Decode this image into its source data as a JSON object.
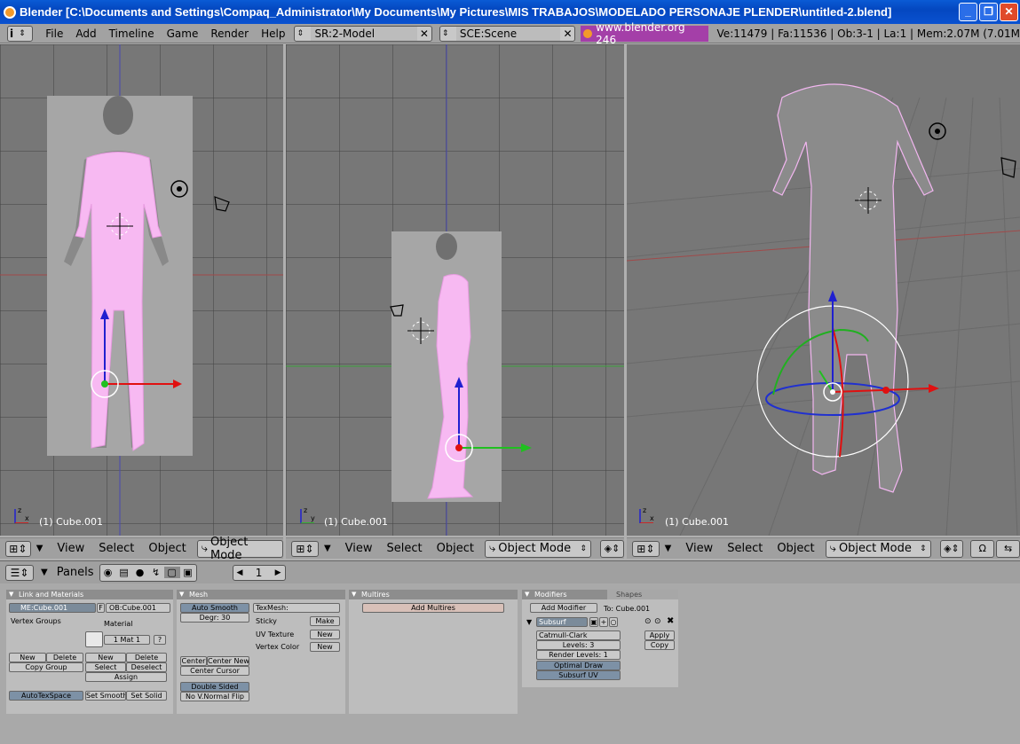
{
  "window": {
    "title": "Blender [C:\\Documents and Settings\\Compaq_Administrator\\My Documents\\My Pictures\\MIS TRABAJOS\\MODELADO PERSONAJE PLENDER\\untitled-2.blend]",
    "minimize": "_",
    "maximize": "❐",
    "close": "✕"
  },
  "info_header": {
    "menus": [
      "File",
      "Add",
      "Timeline",
      "Game",
      "Render",
      "Help"
    ],
    "screen": "SR:2-Model",
    "scene": "SCE:Scene",
    "website": "www.blender.org 246",
    "stats": "Ve:11479 | Fa:11536 | Ob:3-1 | La:1  | Mem:2.07M (7.01M"
  },
  "viewports": [
    {
      "label": "(1) Cube.001"
    },
    {
      "label": "(1) Cube.001"
    },
    {
      "label": "(1) Cube.001"
    }
  ],
  "view_header": {
    "menus": [
      "View",
      "Select",
      "Object"
    ],
    "mode": "Object Mode"
  },
  "buttons_header": {
    "label": "Panels",
    "frame": "1"
  },
  "panels": {
    "link": {
      "title": "Link and Materials",
      "mesh_name": "ME:Cube.001",
      "f_flag": "F",
      "object_name": "OB:Cube.001",
      "vertex_groups": "Vertex Groups",
      "material": "Material",
      "mat_field": "1 Mat 1",
      "q": "?",
      "new1": "New",
      "delete1": "Delete",
      "copy_group": "Copy Group",
      "new2": "New",
      "delete2": "Delete",
      "select": "Select",
      "deselect": "Deselect",
      "assign": "Assign",
      "autotexspace": "AutoTexSpace",
      "set_smooth": "Set Smooth",
      "set_solid": "Set Solid"
    },
    "mesh": {
      "title": "Mesh",
      "auto_smooth": "Auto Smooth",
      "degr": "Degr: 30",
      "texmesh": "TexMesh:",
      "sticky": "Sticky",
      "make": "Make",
      "uv_texture": "UV Texture",
      "uv_new": "New",
      "vertex_color": "Vertex Color",
      "vc_new": "New",
      "center": "Center",
      "center_new": "Center New",
      "center_cursor": "Center Cursor",
      "double_sided": "Double Sided",
      "no_vnormal_flip": "No V.Normal Flip"
    },
    "multires": {
      "title": "Multires",
      "add_multires": "Add Multires"
    },
    "modifiers": {
      "title": "Modifiers",
      "shapes_tab": "Shapes",
      "add_modifier": "Add Modifier",
      "to": "To: Cube.001",
      "subsurf": "Subsurf",
      "catmull": "Catmull-Clark",
      "levels": "Levels: 3",
      "render_levels": "Render Levels: 1",
      "optimal_draw": "Optimal Draw",
      "subsurf_uv": "Subsurf UV",
      "apply": "Apply",
      "copy": "Copy"
    }
  }
}
